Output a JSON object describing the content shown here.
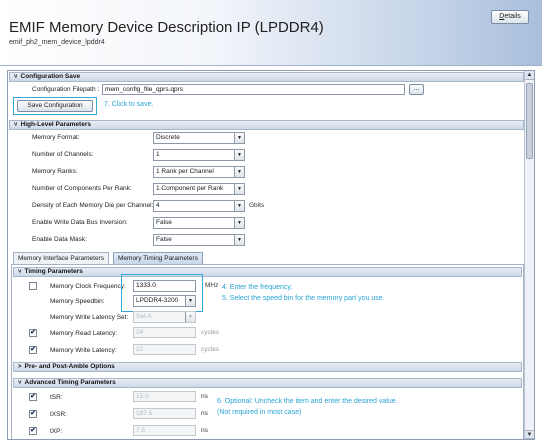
{
  "header": {
    "title": "EMIF Memory Device Description IP (LPDDR4)",
    "subtitle": "emif_ph2_mem_device_lpddr4",
    "details_button": "Details",
    "details_mnemonic": "D",
    "details_rest": "etails"
  },
  "config_save": {
    "section_title": "Configuration Save",
    "filepath_label": "Configuration Filepath :",
    "filepath_value": "mem_config_file_qprs.qprs",
    "browse_button": "...",
    "save_button": "Save Configuration",
    "annotation": "7. Click to save."
  },
  "high_level": {
    "section_title": "High-Level Parameters",
    "rows": [
      {
        "label": "Memory Format:",
        "value": "Discrete",
        "unit": ""
      },
      {
        "label": "Number of Channels:",
        "value": "1",
        "unit": ""
      },
      {
        "label": "Memory Ranks:",
        "value": "1 Rank per Channel",
        "unit": ""
      },
      {
        "label": "Number of Components Per Rank:",
        "value": "1 Component per Rank",
        "unit": ""
      },
      {
        "label": "Density of Each Memory Die per Channel:",
        "value": "4",
        "unit": "Gbits"
      },
      {
        "label": "Enable Write Data Bus Inversion:",
        "value": "False",
        "unit": ""
      },
      {
        "label": "Enable Data Mask:",
        "value": "False",
        "unit": ""
      }
    ]
  },
  "tabs": [
    {
      "label": "Memory Interface Parameters",
      "active": false
    },
    {
      "label": "Memory Timing Parameters",
      "active": true
    }
  ],
  "timing": {
    "section_title": "Timing Parameters",
    "clock_freq_label": "Memory Clock Frequency:",
    "clock_freq_value": "1333.0",
    "clock_freq_unit": "MHz",
    "speedbin_label": "Memory Speedbin:",
    "speedbin_value": "LPDDR4-3200",
    "write_latency_set_label": "Memory Write Latency Set:",
    "write_latency_set_value": "Set A",
    "read_latency_label": "Memory Read Latency:",
    "read_latency_value": "24",
    "read_latency_unit": "cycles",
    "write_latency_label": "Memory Write Latency:",
    "write_latency_value": "22",
    "write_latency_unit": "cycles",
    "annotation_1": "4. Enter the frequency.",
    "annotation_2": "5. Select the speed bin for the memory part you use."
  },
  "pre_post": {
    "section_title": "Pre- and Post-Amble Options"
  },
  "advanced": {
    "section_title": "Advanced Timing Parameters",
    "rows": [
      {
        "label": "tSR:",
        "value": "15.0",
        "unit": "ns",
        "checked": true
      },
      {
        "label": "tXSR:",
        "value": "187.5",
        "unit": "ns",
        "checked": true
      },
      {
        "label": "tXP:",
        "value": "7.5",
        "unit": "ns",
        "checked": true
      }
    ],
    "annotation_1": "6. Optional: Uncheck the item and enter the desired value.",
    "annotation_2": "(Not required in most case)"
  },
  "glyphs": {
    "collapse": "˅",
    "expand": "˃",
    "dropdown": "▼",
    "check": "✔",
    "scroll_up": "▲",
    "scroll_down": "▼"
  },
  "colors": {
    "annotation": "#28a3d4",
    "header_gradient_end": "#a9bfdc"
  }
}
